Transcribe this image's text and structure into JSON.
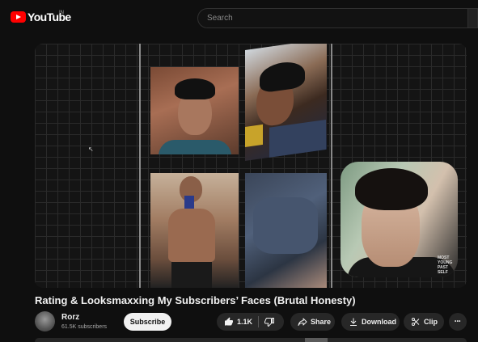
{
  "topbar": {
    "logo_text": "YouTube",
    "region": "IN",
    "search_placeholder": "Search"
  },
  "facecam": {
    "caption": "MOST\nYOUNG\nPAST\nSELF"
  },
  "video": {
    "title": "Rating & Looksmaxxing My Subscribers’ Faces (Brutal Honesty)"
  },
  "channel": {
    "name": "Rorz",
    "subscribers": "61.5K subscribers",
    "subscribe_label": "Subscribe"
  },
  "actions": {
    "like_count": "1.1K",
    "share_label": "Share",
    "download_label": "Download",
    "clip_label": "Clip",
    "more_label": "•••"
  },
  "icons": {
    "logo": "youtube-logo-icon",
    "like": "thumbs-up-icon",
    "dislike": "thumbs-down-icon",
    "share": "share-arrow-icon",
    "download": "download-icon",
    "clip": "scissors-icon",
    "more": "more-horizontal-icon",
    "cursor": "mouse-cursor-icon"
  },
  "colors": {
    "background": "#0f0f0f",
    "brand_red": "#ff0000",
    "pill_bg": "#272727",
    "subscribe_bg": "#f1f1f1"
  }
}
